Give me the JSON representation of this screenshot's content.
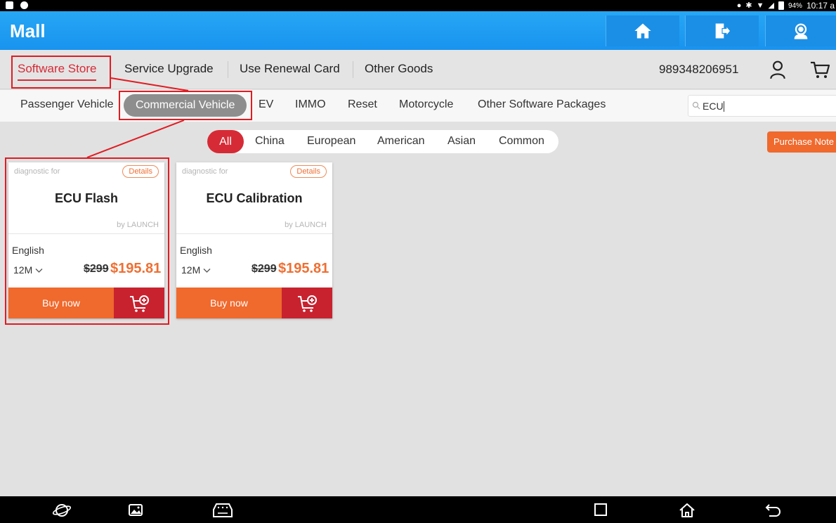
{
  "status_bar": {
    "battery": "94%",
    "time": "10:17 a"
  },
  "app": {
    "title": "Mall"
  },
  "header_buttons": [
    {
      "icon": "home-icon"
    },
    {
      "icon": "exit-icon"
    },
    {
      "icon": "support-agent-icon"
    }
  ],
  "main_tabs": [
    "Software Store",
    "Service Upgrade",
    "Use Renewal Card",
    "Other Goods"
  ],
  "account": {
    "id": "989348206951"
  },
  "sub_tabs": [
    "Passenger Vehicle",
    "Commercial Vehicle",
    "EV",
    "IMMO",
    "Reset",
    "Motorcycle",
    "Other Software Packages"
  ],
  "search": {
    "value": "ECU"
  },
  "regions": [
    "All",
    "China",
    "European",
    "American",
    "Asian",
    "Common"
  ],
  "purchase_note": "Purchase Note",
  "products": [
    {
      "category": "diagnostic for",
      "details_label": "Details",
      "name": "ECU Flash",
      "vendor": "by LAUNCH",
      "language": "English",
      "duration": "12M",
      "old_price": "$299",
      "price": "$195.81",
      "buy_label": "Buy now"
    },
    {
      "category": "diagnostic for",
      "details_label": "Details",
      "name": "ECU Calibration",
      "vendor": "by LAUNCH",
      "language": "English",
      "duration": "12M",
      "old_price": "$299",
      "price": "$195.81",
      "buy_label": "Buy now"
    }
  ],
  "colors": {
    "app_bar": "#1a94ef",
    "accent_red": "#d62b36",
    "orange": "#f0692d",
    "annotation_red": "#e11b22"
  }
}
